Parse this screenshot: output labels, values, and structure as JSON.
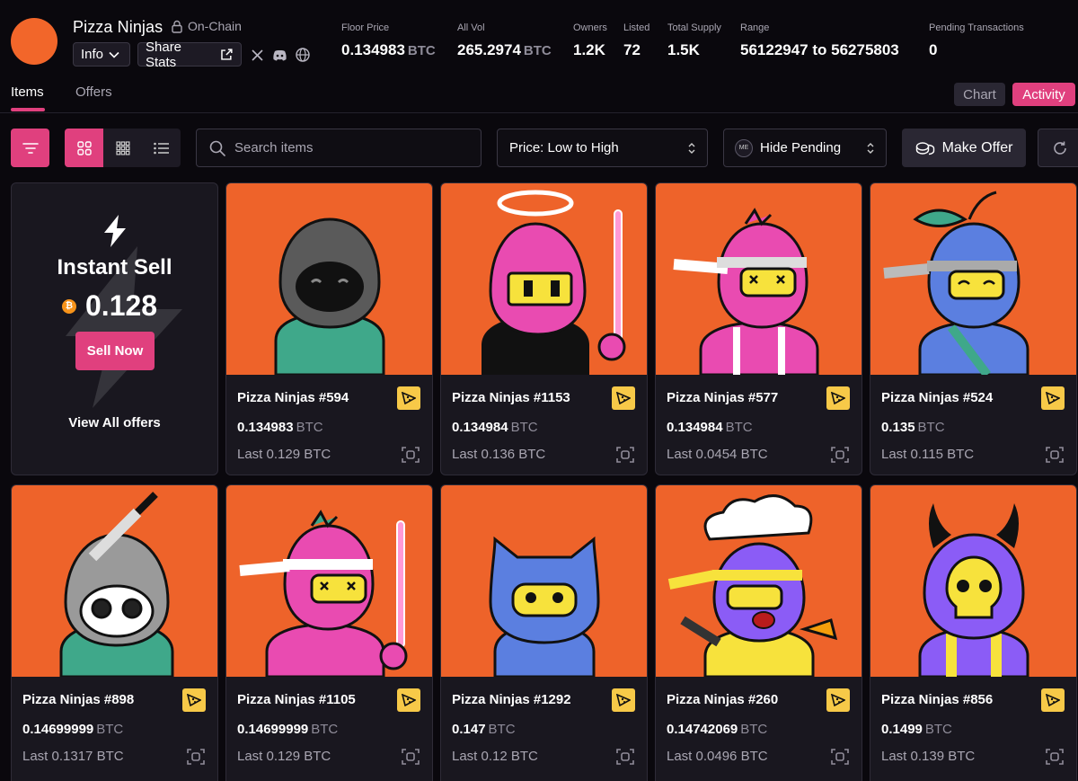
{
  "collection": {
    "name": "Pizza Ninjas",
    "onchain_label": "On-Chain",
    "info_label": "Info",
    "share_label": "Share Stats",
    "logo_color": "#f2662a"
  },
  "stats": [
    {
      "label": "Floor Price",
      "value": "0.134983",
      "unit": "BTC"
    },
    {
      "label": "All Vol",
      "value": "265.2974",
      "unit": "BTC"
    },
    {
      "label": "Owners",
      "value": "1.2K",
      "unit": ""
    },
    {
      "label": "Listed",
      "value": "72",
      "unit": ""
    },
    {
      "label": "Total Supply",
      "value": "1.5K",
      "unit": ""
    },
    {
      "label": "Range",
      "value": "56122947 to 56275803",
      "unit": ""
    },
    {
      "label": "Pending Transactions",
      "value": "0",
      "unit": ""
    }
  ],
  "tabs": {
    "items": "Items",
    "offers": "Offers",
    "chart": "Chart",
    "activity": "Activity"
  },
  "toolbar": {
    "search_placeholder": "Search items",
    "sort_value": "Price: Low to High",
    "pending_value": "Hide Pending",
    "make_offer": "Make Offer"
  },
  "instant_sell": {
    "title": "Instant Sell",
    "price": "0.128",
    "button": "Sell Now",
    "view_all": "View All offers"
  },
  "items": [
    {
      "name": "Pizza Ninjas #594",
      "price": "0.134983",
      "unit": "BTC",
      "last": "Last 0.129 BTC"
    },
    {
      "name": "Pizza Ninjas #1153",
      "price": "0.134984",
      "unit": "BTC",
      "last": "Last 0.136 BTC"
    },
    {
      "name": "Pizza Ninjas #577",
      "price": "0.134984",
      "unit": "BTC",
      "last": "Last 0.0454 BTC"
    },
    {
      "name": "Pizza Ninjas #524",
      "price": "0.135",
      "unit": "BTC",
      "last": "Last 0.115 BTC"
    },
    {
      "name": "Pizza Ninjas #898",
      "price": "0.14699999",
      "unit": "BTC",
      "last": "Last 0.1317 BTC"
    },
    {
      "name": "Pizza Ninjas #1105",
      "price": "0.14699999",
      "unit": "BTC",
      "last": "Last 0.129 BTC"
    },
    {
      "name": "Pizza Ninjas #1292",
      "price": "0.147",
      "unit": "BTC",
      "last": "Last 0.12 BTC"
    },
    {
      "name": "Pizza Ninjas #260",
      "price": "0.14742069",
      "unit": "BTC",
      "last": "Last 0.0496 BTC"
    },
    {
      "name": "Pizza Ninjas #856",
      "price": "0.1499",
      "unit": "BTC",
      "last": "Last 0.139 BTC"
    }
  ],
  "colors": {
    "accent": "#e0407e",
    "art_background": "#ee632a",
    "badge": "#f7c948",
    "btc": "#f7931a"
  }
}
